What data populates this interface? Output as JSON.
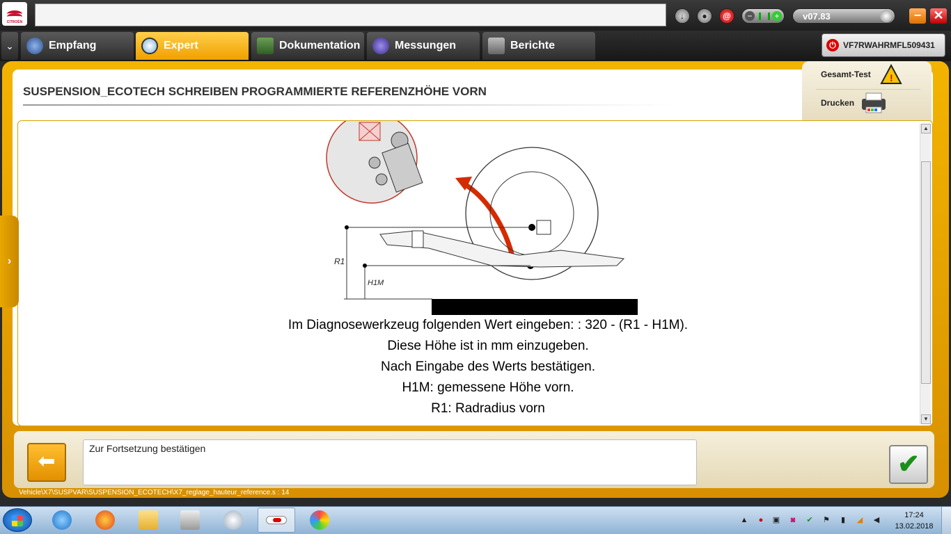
{
  "app": {
    "logo_text": "CITROËN",
    "version": "v07.83",
    "vin": "VF7RWAHRMFL509431"
  },
  "tabs": [
    {
      "label": "Empfang"
    },
    {
      "label": "Expert"
    },
    {
      "label": "Dokumentation"
    },
    {
      "label": "Messungen"
    },
    {
      "label": "Berichte"
    }
  ],
  "page": {
    "title": "SUSPENSION_ECOTECH  SCHREIBEN PROGRAMMIERTE REFERENZHÖHE VORN",
    "actions": {
      "gesamt_test": "Gesamt-Test",
      "drucken": "Drucken"
    }
  },
  "diagram": {
    "label_r1": "R1",
    "label_h1m": "H1M"
  },
  "instructions": [
    "Im Diagnosewerkzeug folgenden Wert eingeben: : 320 - (R1 - H1M).",
    "Diese Höhe ist in mm einzugeben.",
    "Nach Eingabe des Werts bestätigen.",
    "H1M: gemessene Höhe vorn.",
    "R1: Radradius vorn"
  ],
  "bottom": {
    "message": "Zur Fortsetzung bestätigen",
    "path": "Vehicle\\X7\\SUSPVAR\\SUSPENSION_ECOTECH\\X7_reglage_hauteur_reference.s : 14"
  },
  "taskbar": {
    "time": "17:24",
    "date": "13.02.2018"
  },
  "colors": {
    "accent": "#f0a000",
    "frame": "#e8a700",
    "ok_check": "#1b8f1b",
    "arrow_red": "#d52b00"
  }
}
